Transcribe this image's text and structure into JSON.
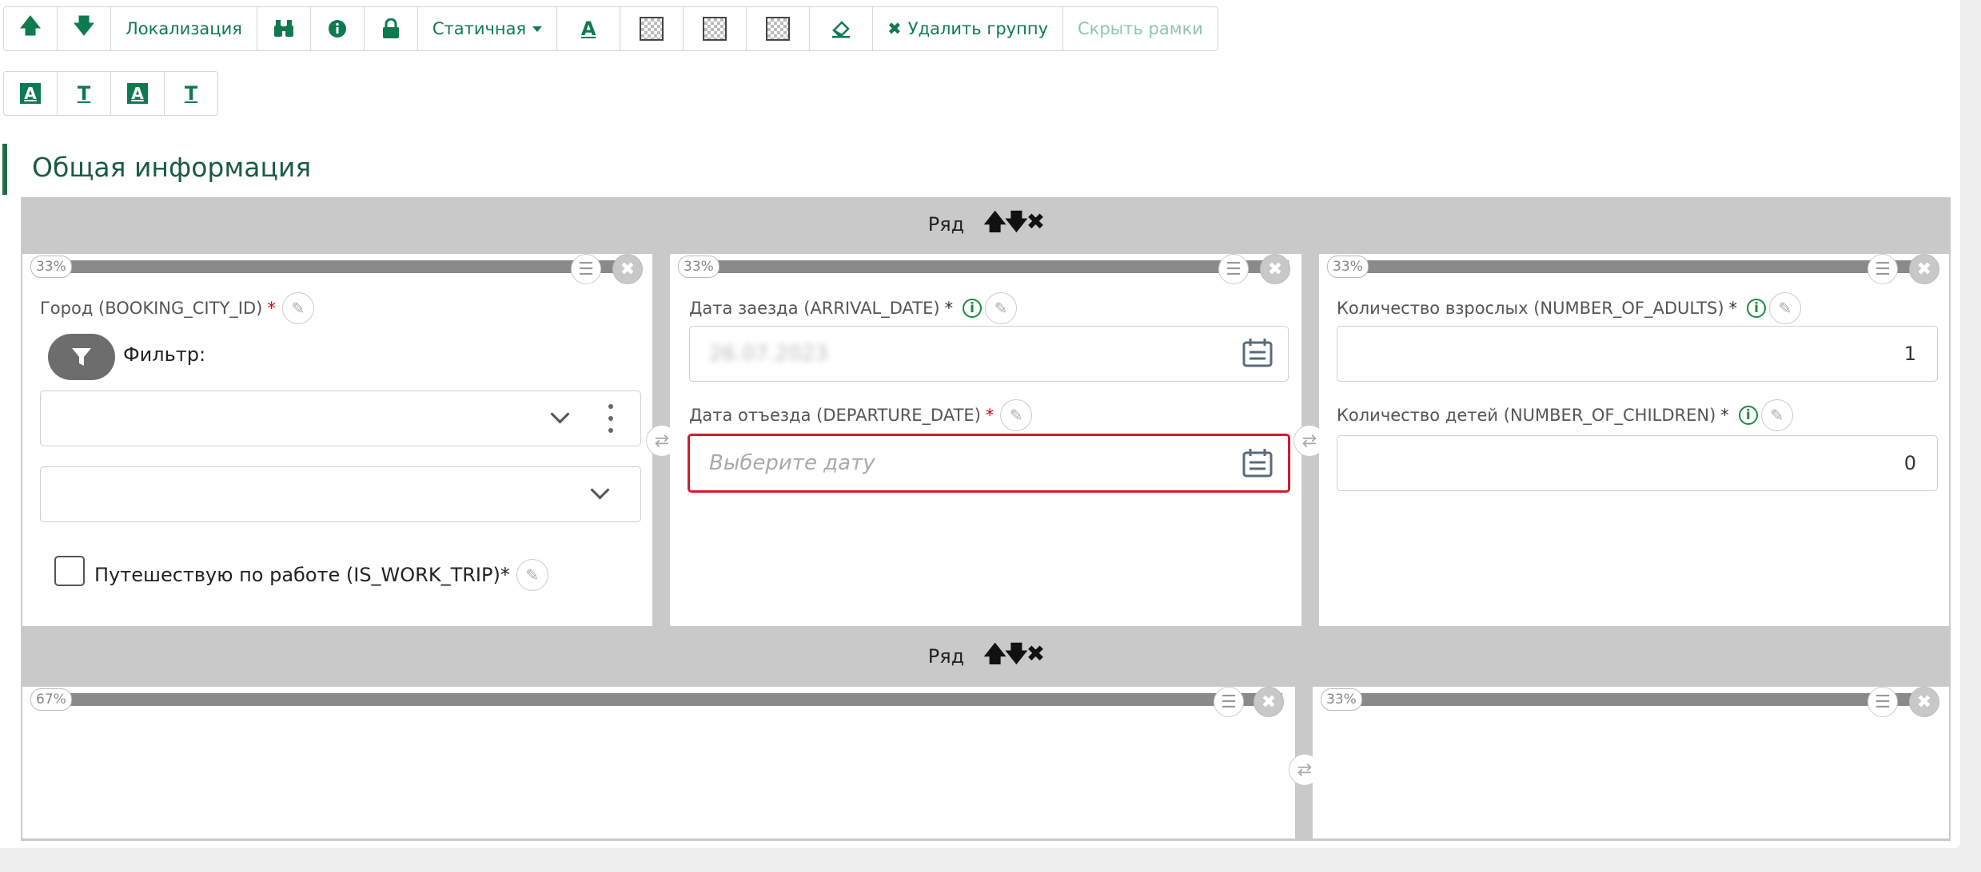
{
  "toolbar1": {
    "localization": "Локализация",
    "static": "Статичная",
    "text_color": "A",
    "delete_group": "Удалить группу",
    "hide_frames": "Скрыть рамки"
  },
  "toolbar2": {
    "a1": "A",
    "t1": "T",
    "a2": "A",
    "t2": "T"
  },
  "section_title": "Общая информация",
  "row_label": "Ряд",
  "row_arrows": "🡅🡇✖",
  "row1": {
    "col1": {
      "pct": "33%",
      "city_label": "Город (BOOKING_CITY_ID)",
      "req": "*",
      "filter_label": "Фильтр:",
      "work_trip_label": "Путешествую по работе (IS_WORK_TRIP)*"
    },
    "col2": {
      "pct": "33%",
      "arrival_label": "Дата заезда (ARRIVAL_DATE)",
      "arrival_req": "*",
      "arrival_value": "26.07.2023",
      "departure_label": "Дата отъезда (DEPARTURE_DATE)",
      "departure_req": "*",
      "departure_placeholder": "Выберите дату"
    },
    "col3": {
      "pct": "33%",
      "adults_label": "Количество взрослых (NUMBER_OF_ADULTS)",
      "adults_req": "*",
      "adults_value": "1",
      "children_label": "Количество детей (NUMBER_OF_CHILDREN)",
      "children_req": "*",
      "children_value": "0"
    }
  },
  "row2": {
    "col1": {
      "pct": "67%"
    },
    "col2": {
      "pct": "33%"
    }
  }
}
